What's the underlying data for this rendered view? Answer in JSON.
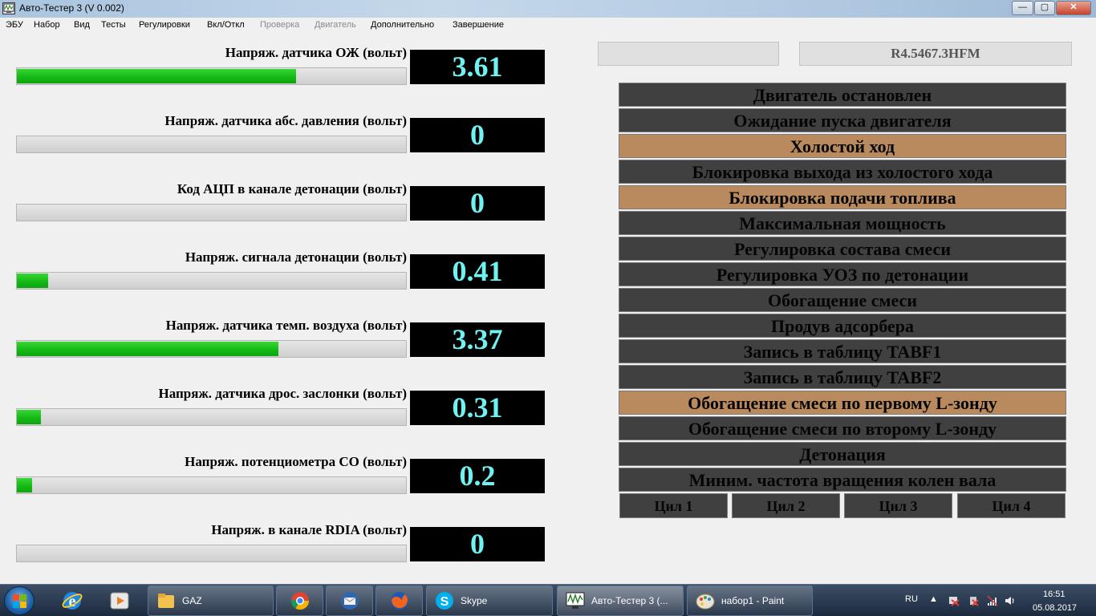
{
  "window": {
    "title": "Авто-Тестер 3  (V 0.002)",
    "min_label": "—",
    "max_label": "▢",
    "close_label": "✕"
  },
  "menu": [
    {
      "label": "ЭБУ",
      "enabled": true
    },
    {
      "label": "Набор",
      "enabled": true
    },
    {
      "label": "Вид",
      "enabled": true
    },
    {
      "label": "Тесты",
      "enabled": true
    },
    {
      "label": "Регулировки",
      "enabled": true
    },
    {
      "label": "Вкл/Откл",
      "enabled": true
    },
    {
      "label": "Проверка",
      "enabled": false
    },
    {
      "label": "Двигатель",
      "enabled": false
    },
    {
      "label": "Дополнительно",
      "enabled": true
    },
    {
      "label": "Завершение",
      "enabled": true
    }
  ],
  "sensors": [
    {
      "label": "Напряж. датчика ОЖ (вольт)",
      "value": "3.61",
      "fill": 0.717
    },
    {
      "label": "Напряж. датчика абс. давления (вольт)",
      "value": "0",
      "fill": 0
    },
    {
      "label": "Код АЦП в канале детонации (вольт)",
      "value": "0",
      "fill": 0
    },
    {
      "label": "Напряж. сигнала детонации (вольт)",
      "value": "0.41",
      "fill": 0.08
    },
    {
      "label": "Напряж. датчика темп. воздуха (вольт)",
      "value": "3.37",
      "fill": 0.672
    },
    {
      "label": "Напряж. датчика дрос. заслонки (вольт)",
      "value": "0.31",
      "fill": 0.061
    },
    {
      "label": "Напряж. потенциометра СО (вольт)",
      "value": "0.2",
      "fill": 0.039
    },
    {
      "label": "Напряж.  в канале RDIA (вольт)",
      "value": "0",
      "fill": 0
    }
  ],
  "info": {
    "left_box": "",
    "firmware": "R4.5467.3HFM"
  },
  "statuses": [
    {
      "label": "Двигатель остановлен",
      "active": false
    },
    {
      "label": "Ожидание пуска двигателя",
      "active": false
    },
    {
      "label": "Холостой ход",
      "active": true
    },
    {
      "label": "Блокировка выхода из холостого хода",
      "active": false
    },
    {
      "label": "Блокировка подачи топлива",
      "active": true
    },
    {
      "label": "Максимальная мощность",
      "active": false
    },
    {
      "label": "Регулировка состава смеси",
      "active": false
    },
    {
      "label": "Регулировка УОЗ по детонации",
      "active": false
    },
    {
      "label": "Обогащение смеси",
      "active": false
    },
    {
      "label": "Продув адсорбера",
      "active": false
    },
    {
      "label": "Запись в таблицу TABF1",
      "active": false
    },
    {
      "label": "Запись в таблицу TABF2",
      "active": false
    },
    {
      "label": "Обогащение смеси по первому L-зонду",
      "active": true
    },
    {
      "label": "Обогащение смеси по второму L-зонду",
      "active": false
    },
    {
      "label": "Детонация",
      "active": false
    },
    {
      "label": "Миним. частота вращения колен вала",
      "active": false
    }
  ],
  "cylinders": [
    "Цил 1",
    "Цил 2",
    "Цил 3",
    "Цил 4"
  ],
  "colors": {
    "status_active": "#b98a5d",
    "status_inactive": "#404040",
    "bar_fill": "#13b813",
    "value_text": "#6ff2f2"
  },
  "taskbar": {
    "pinned": [
      {
        "name": "internet-explorer-icon"
      },
      {
        "name": "media-player-icon"
      }
    ],
    "tasks": [
      {
        "label": "GAZ",
        "icon": "folder-icon",
        "active": false
      },
      {
        "label": "",
        "icon": "chrome-icon",
        "active": false
      },
      {
        "label": "",
        "icon": "thunderbird-icon",
        "active": false
      },
      {
        "label": "",
        "icon": "firefox-icon",
        "active": false
      },
      {
        "label": "Skype",
        "icon": "skype-icon",
        "active": false
      },
      {
        "label": "Авто-Тестер 3  (...",
        "icon": "autotester-icon",
        "active": true
      },
      {
        "label": "набор1 - Paint",
        "icon": "paint-icon",
        "active": false
      }
    ],
    "language": "RU",
    "time": "16:51",
    "date": "05.08.2017"
  }
}
